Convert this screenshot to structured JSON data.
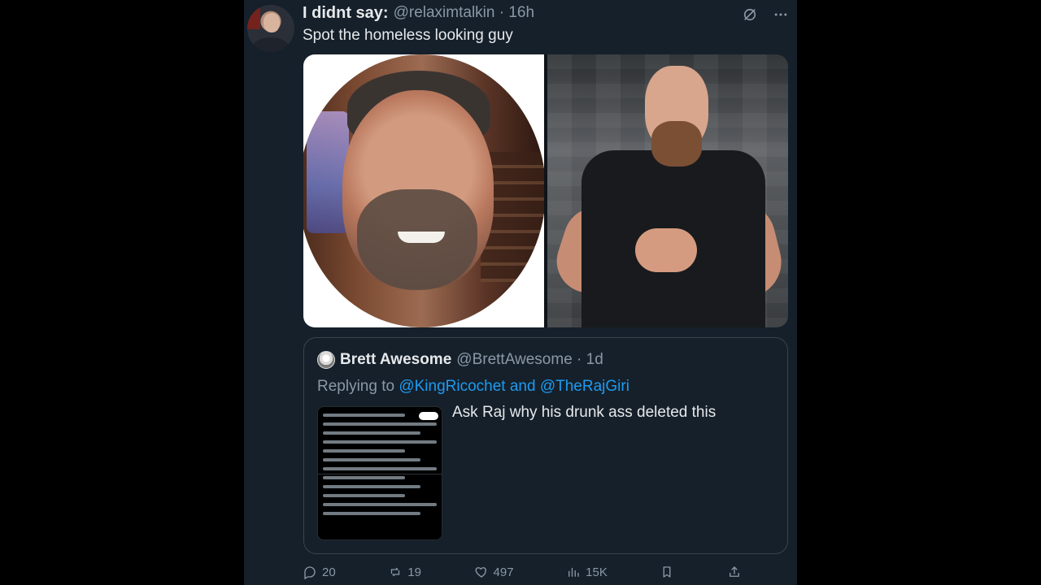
{
  "tweet": {
    "author": {
      "display_name": "I didnt say:",
      "handle_time": "@relaximtalkin · 16h"
    },
    "text": "Spot the homeless looking guy",
    "actions": {
      "replies": "20",
      "reposts": "19",
      "likes": "497",
      "views": "15K"
    }
  },
  "quoted_tweet": {
    "author": {
      "display_name": "Brett Awesome",
      "handle_time": "@BrettAwesome · 1d"
    },
    "replying_prefix": "Replying to ",
    "replying_to": "@KingRicochet and @TheRajGiri",
    "text": "Ask Raj why his drunk ass deleted this"
  },
  "icons": {
    "header": [
      "grok-icon",
      "more-icon"
    ],
    "actions": [
      "reply-icon",
      "repost-icon",
      "like-icon",
      "views-icon",
      "bookmark-icon",
      "share-icon"
    ]
  },
  "colors": {
    "background": "#15202b",
    "border": "#38444d",
    "primary_text": "#e7e9ea",
    "secondary_text": "#8b98a5",
    "link": "#1d9bf0"
  }
}
